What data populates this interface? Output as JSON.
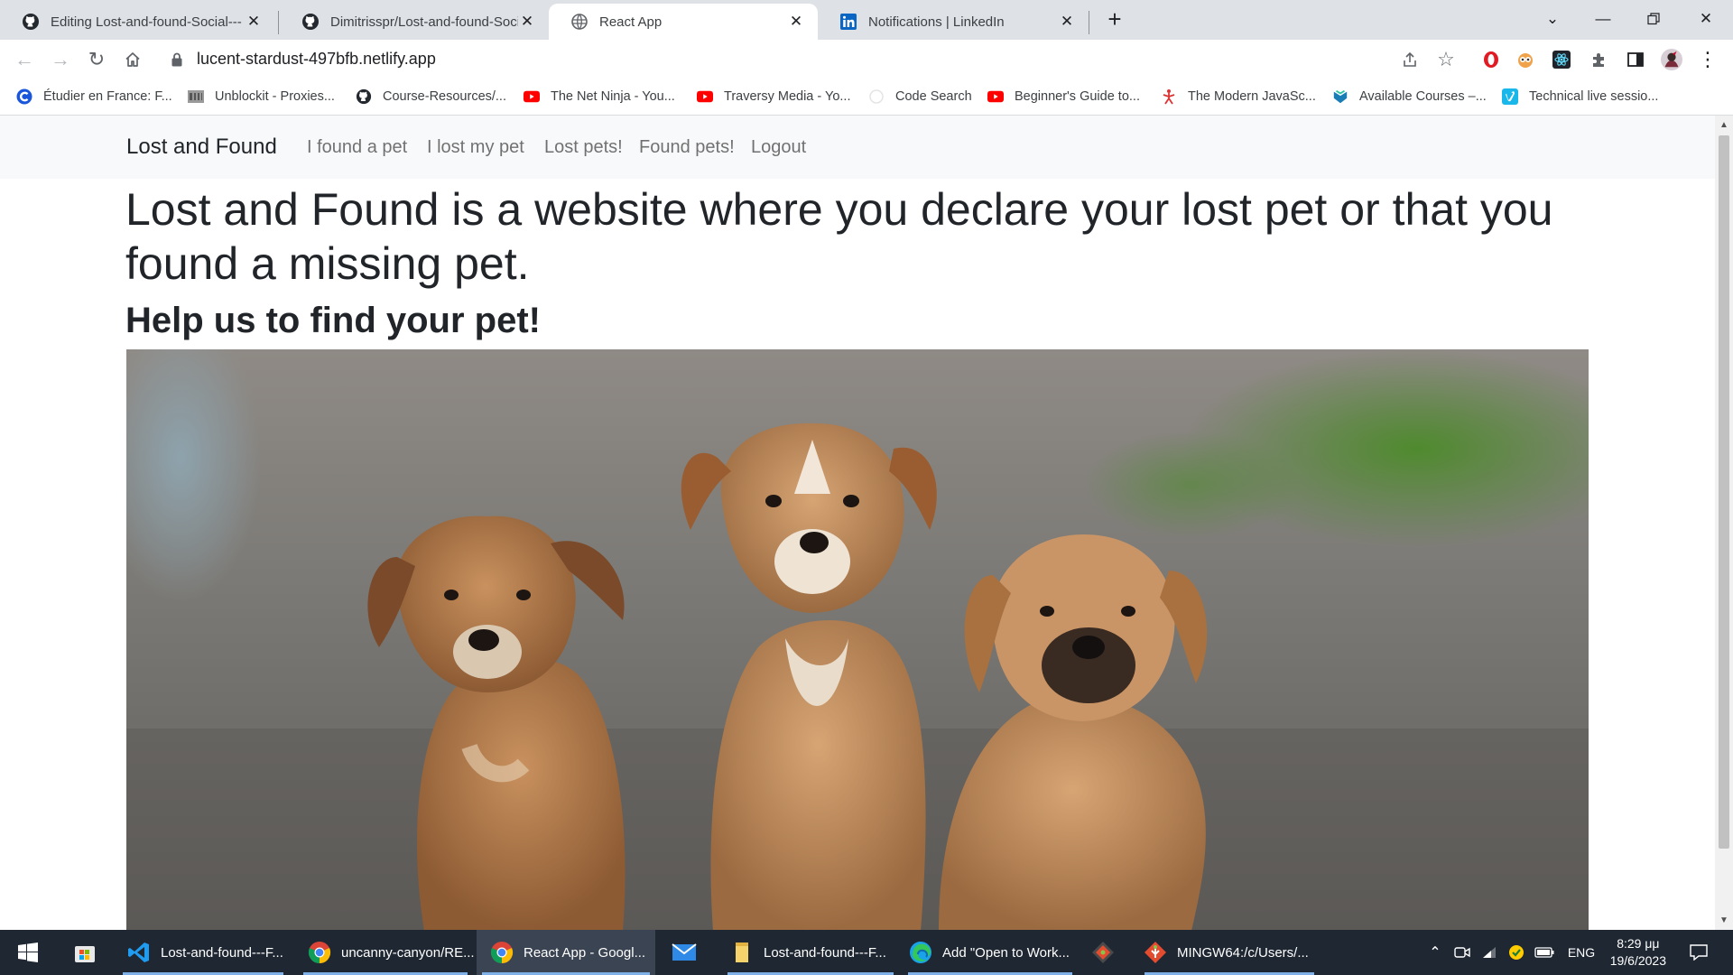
{
  "browser": {
    "tabs": [
      {
        "title": "Editing Lost-and-found-Social---",
        "favicon": "github-icon",
        "active": false
      },
      {
        "title": "Dimitrisspr/Lost-and-found-Socia",
        "favicon": "github-icon",
        "active": false
      },
      {
        "title": "React App",
        "favicon": "globe-icon",
        "active": true
      },
      {
        "title": "Notifications | LinkedIn",
        "favicon": "linkedin-icon",
        "active": false
      }
    ],
    "new_tab_label": "+",
    "url": "lucent-stardust-497bfb.netlify.app",
    "bookmarks": [
      {
        "label": "Étudier en France: F...",
        "icon": "campus-france-icon",
        "color": "#1a56db"
      },
      {
        "label": "Unblockit - Proxies...",
        "icon": "unblockit-icon",
        "color": "#777777"
      },
      {
        "label": "Course-Resources/...",
        "icon": "github-icon",
        "color": "#222222"
      },
      {
        "label": "The Net Ninja - You...",
        "icon": "youtube-icon",
        "color": "#ff0000"
      },
      {
        "label": "Traversy Media - Yo...",
        "icon": "youtube-icon",
        "color": "#ff0000"
      },
      {
        "label": "Code Search",
        "icon": "code-search-icon",
        "color": "#9e9e9e"
      },
      {
        "label": "Beginner's Guide to...",
        "icon": "youtube-icon",
        "color": "#ff0000"
      },
      {
        "label": "The Modern JavaSc...",
        "icon": "javascript-info-icon",
        "color": "#dd3333"
      },
      {
        "label": "Available Courses –...",
        "icon": "courses-icon",
        "color": "#1b7db5"
      },
      {
        "label": "Technical live sessio...",
        "icon": "vimeo-icon",
        "color": "#1ab7ea"
      }
    ]
  },
  "app": {
    "brand": "Lost and Found",
    "nav": [
      "I found a pet",
      "I lost my pet",
      "Lost pets!",
      "Found pets!",
      "Logout"
    ],
    "heading": "Lost and Found is a website where you declare your lost pet or that you found a missing pet.",
    "subheading": "Help us to find your pet!",
    "hero_image": "three-puppies-photo"
  },
  "taskbar": {
    "items": [
      {
        "label": "",
        "icon": "windows-start-icon"
      },
      {
        "label": "",
        "icon": "microsoft-store-icon"
      },
      {
        "label": "Lost-and-found---F...",
        "icon": "vscode-icon",
        "active": false
      },
      {
        "label": "uncanny-canyon/RE...",
        "icon": "chrome-icon",
        "active": false
      },
      {
        "label": "React App - Googl...",
        "icon": "chrome-icon",
        "active": true
      },
      {
        "label": "",
        "icon": "mail-icon"
      },
      {
        "label": "Lost-and-found---F...",
        "icon": "file-explorer-icon",
        "active": false
      },
      {
        "label": "Add \"Open to Work...",
        "icon": "edge-icon",
        "active": false
      },
      {
        "label": "",
        "icon": "git-gui-icon"
      },
      {
        "label": "MINGW64:/c/Users/...",
        "icon": "git-bash-icon",
        "active": false
      }
    ],
    "language": "ENG",
    "time": "8:29 μμ",
    "date": "19/6/2023"
  }
}
